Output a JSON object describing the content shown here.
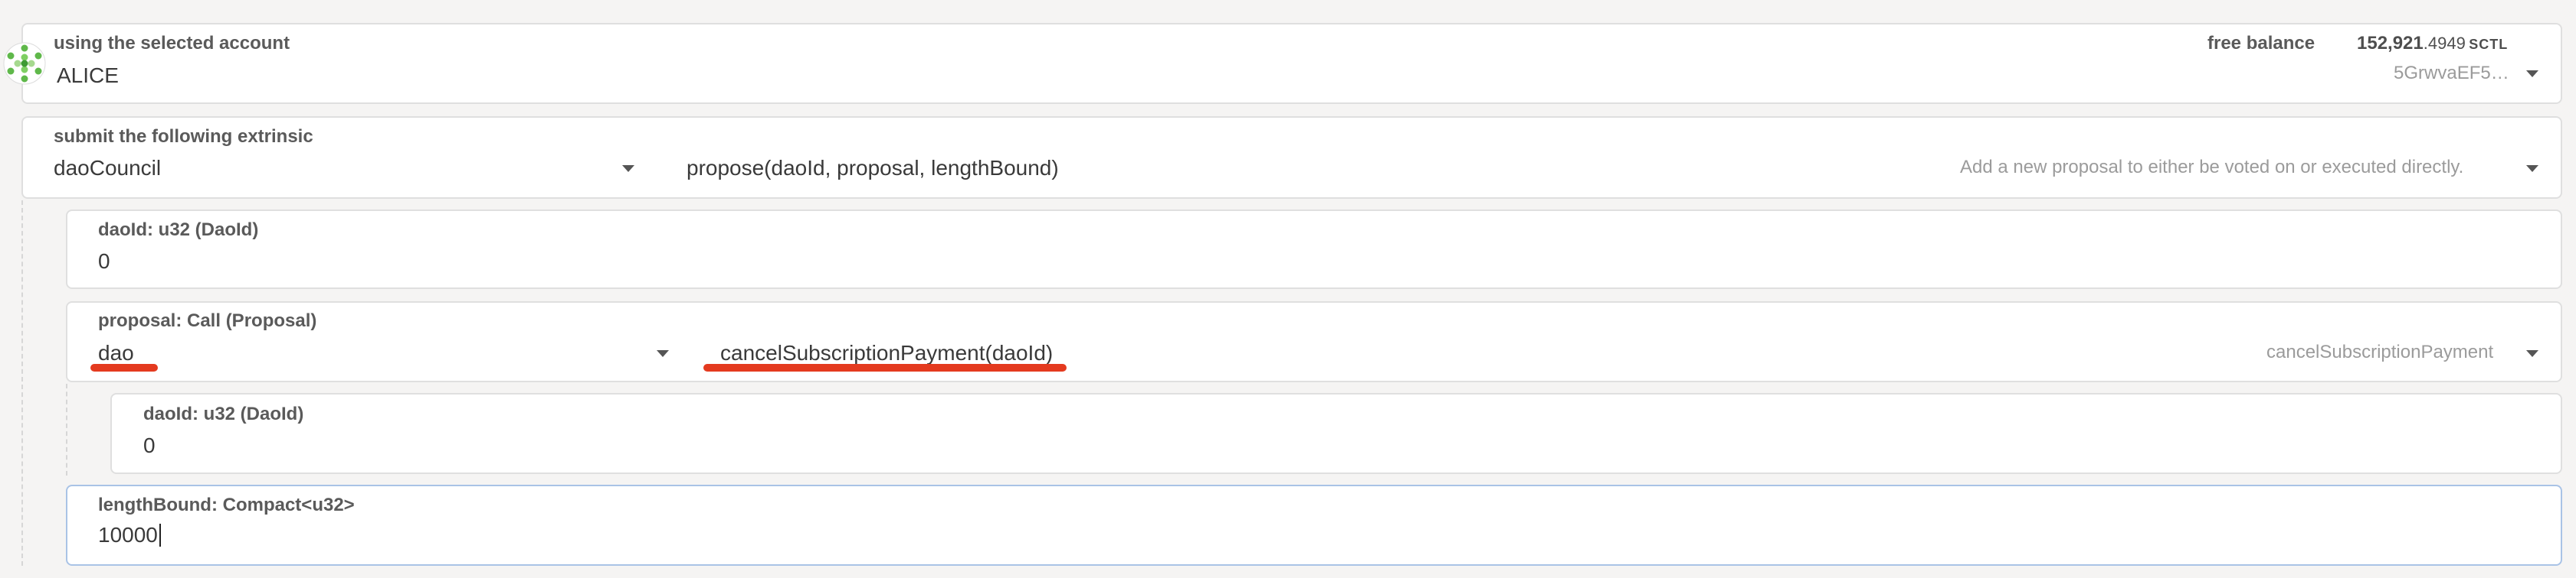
{
  "account": {
    "label": "using the selected account",
    "name": "ALICE",
    "balance_label": "free balance",
    "balance_int": "152,921",
    "balance_dec": ".4949",
    "balance_unit": "SCTL",
    "address": "5GrwvaEF5…"
  },
  "extrinsic": {
    "label": "submit the following extrinsic",
    "section": "daoCouncil",
    "method": "propose(daoId, proposal, lengthBound)",
    "description": "Add a new proposal to either be voted on or executed directly."
  },
  "params": {
    "dao_id": {
      "label": "daoId: u32 (DaoId)",
      "value": "0"
    },
    "proposal": {
      "label": "proposal: Call (Proposal)",
      "section": "dao",
      "method": "cancelSubscriptionPayment(daoId)",
      "method_hint": "cancelSubscriptionPayment",
      "dao_id": {
        "label": "daoId: u32 (DaoId)",
        "value": "0"
      }
    },
    "length_bound": {
      "label": "lengthBound: Compact<u32>",
      "value": "10000"
    }
  },
  "colors": {
    "annotation": "#e43a1f",
    "focus_border": "#a9c3e6",
    "identicon": "#5fb84a"
  },
  "icons": {
    "account_avatar": "identicon"
  }
}
